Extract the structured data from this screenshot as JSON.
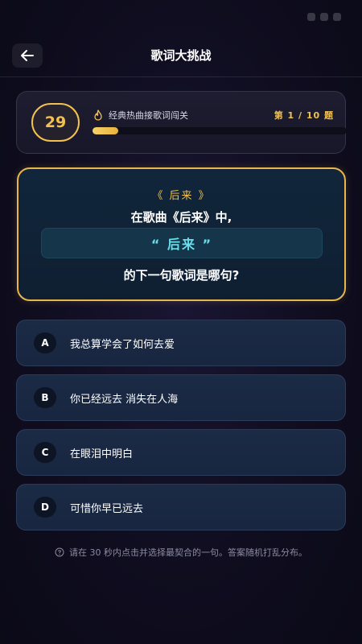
{
  "header": {
    "title": "歌词大挑战",
    "back_icon": "arrow-left-icon"
  },
  "progress": {
    "timer_value": "29",
    "level_icon": "fire-icon",
    "level_title": "经典热曲接歌词闯关",
    "question_counter": "第 1 / 10 题",
    "completion_fraction": 0.1
  },
  "question": {
    "song_tag": "《 后来 》",
    "prompt_line1": "在歌曲《后来》中,",
    "lyric": "“ 后来 ”",
    "prompt_line2": "的下一句歌词是哪句?"
  },
  "options": [
    {
      "letter": "A",
      "text": "我总算学会了如何去爱"
    },
    {
      "letter": "B",
      "text": "你已经远去 消失在人海"
    },
    {
      "letter": "C",
      "text": "在眼泪中明白"
    },
    {
      "letter": "D",
      "text": "可惜你早已远去"
    }
  ],
  "hint": {
    "icon": "help-circle-icon",
    "text": "请在 30 秒内点击并选择最契合的一句。答案随机打乱分布。"
  },
  "colors": {
    "accent_gold": "#f2c14e",
    "lyric_cyan": "#66e0ec",
    "background": "#0f0d1f"
  }
}
